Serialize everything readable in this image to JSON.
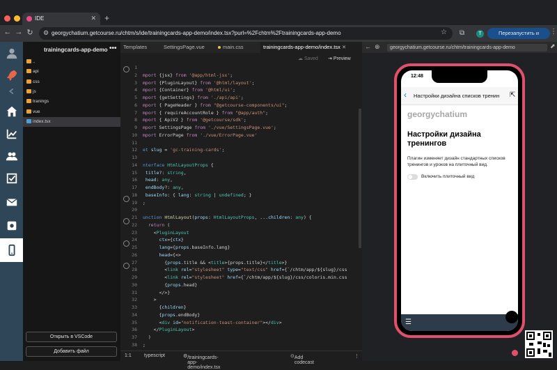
{
  "browser": {
    "tab_title": "IDE",
    "url": "georgychatium.getcourse.ru/chtm/s/ide/trainingcards-app-demo/index.tsx?purl=%2Fchtm%2Ftrainingcards-app-demo",
    "relaunch_label": "Перезапустить и обновить",
    "profile_initial": "T"
  },
  "explorer": {
    "project_title": "trainingcards-app-demo",
    "items": [
      {
        "name": "..",
        "type": "folder"
      },
      {
        "name": "api",
        "type": "folder"
      },
      {
        "name": "css",
        "type": "folder"
      },
      {
        "name": "js",
        "type": "folder"
      },
      {
        "name": "tranings",
        "type": "folder"
      },
      {
        "name": "vue",
        "type": "folder"
      },
      {
        "name": "index.tsx",
        "type": "file"
      }
    ],
    "open_vscode_label": "Открыть в VSCode",
    "add_file_label": "Добавить файл"
  },
  "editor": {
    "tabs": [
      "Templates",
      "SettingsPage.vue",
      "main.css",
      "trainingcards-app-demo/index.tsx"
    ],
    "active_tab": "trainingcards-app-demo/index.tsx",
    "saved_label": "Saved",
    "preview_label": "Preview",
    "status": {
      "position": "1:1",
      "language": "typescript",
      "path": "/trainingcards-app-demo/index.tsx",
      "add_codecast": "Add codecast"
    }
  },
  "preview": {
    "url": "georgychatium.getcourse.ru/chtm/trainingcards-app-demo",
    "time": "12:48",
    "sheet_title": "Настройки дизайна списков тренин",
    "brand": "georgychatium",
    "heading": "Настройки дизайна тренингов",
    "description": "Плагин изменяет дизайн стандартных списков тренингов и уроков на плиточный вид.",
    "toggle_label": "Включить плиточный вид",
    "toggle_on": false
  },
  "colors": {
    "accent_pink": "#e0506a",
    "rail_bg": "#2f4658",
    "relaunch_btn": "#1a4f8c"
  }
}
